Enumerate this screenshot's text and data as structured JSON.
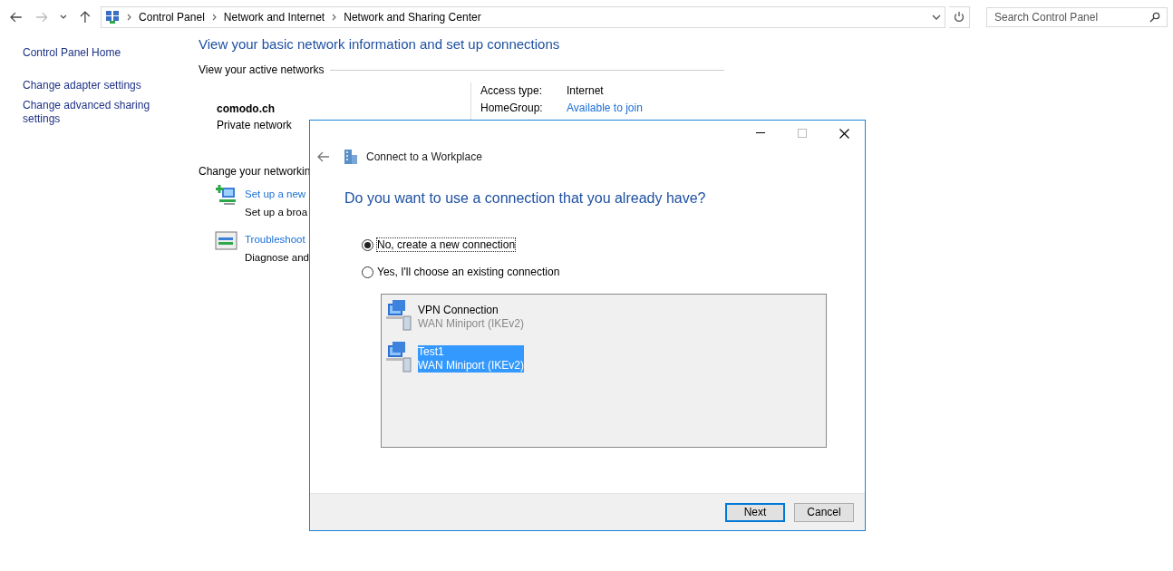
{
  "address_bar": {
    "breadcrumbs": [
      "Control Panel",
      "Network and Internet",
      "Network and Sharing Center"
    ]
  },
  "search": {
    "placeholder": "Search Control Panel"
  },
  "sidebar": {
    "items": [
      "Control Panel Home",
      "Change adapter settings",
      "Change advanced sharing settings"
    ]
  },
  "main": {
    "title": "View your basic network information and set up connections",
    "active_networks_heading": "View your active networks",
    "network": {
      "name": "comodo.ch",
      "type": "Private network"
    },
    "details": [
      {
        "label": "Access type:",
        "value": "Internet",
        "kind": "text"
      },
      {
        "label": "HomeGroup:",
        "value": "Available to join",
        "kind": "link"
      }
    ],
    "settings_heading": "Change your networkin",
    "tasks": [
      {
        "kind": "new",
        "link": "Set up a new",
        "description": "Set up a broa"
      },
      {
        "kind": "troubleshoot",
        "link": "Troubleshoot",
        "description": "Diagnose and"
      }
    ]
  },
  "dialog": {
    "title": "Connect to a Workplace",
    "question": "Do you want to use a connection that you already have?",
    "options": [
      {
        "label": "No, create a new connection",
        "selected": true
      },
      {
        "label": "Yes, I'll choose an existing connection",
        "selected": false
      }
    ],
    "connections": [
      {
        "name": "VPN Connection",
        "device": "WAN Miniport (IKEv2)",
        "selected": false
      },
      {
        "name": "Test1",
        "device": "WAN Miniport (IKEv2)",
        "selected": true
      }
    ],
    "buttons": [
      {
        "label": "Next",
        "kind": "default"
      },
      {
        "label": "Cancel",
        "kind": "normal"
      }
    ]
  }
}
